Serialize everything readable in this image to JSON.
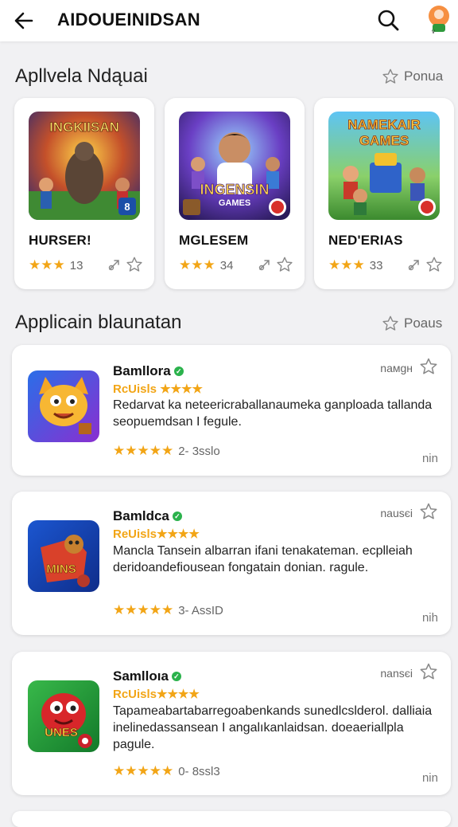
{
  "header": {
    "title": "AIDOUEINIDSAN"
  },
  "featured": {
    "title": "Apllvela Ndąuai",
    "action": "Ponua",
    "cards": [
      {
        "art_text": "INGKIISAN",
        "name": "HURSER!",
        "rating_text": "13"
      },
      {
        "art_text": "INGENSIN",
        "art_sub": "GAMES",
        "name": "MGLESEM",
        "rating_text": "34"
      },
      {
        "art_text": "NAMEKAIR",
        "art_sub": "GAMES",
        "name": "NED'ERIAS",
        "rating_text": "33"
      }
    ]
  },
  "list": {
    "title": "Applicain blaunatan",
    "action": "Poaus",
    "items": [
      {
        "name": "Bamllora",
        "sub": "RcUisls ★★★★",
        "desc": "Redarvat ka neteericraballanaumeka ganploada tallanda seopuemdsan I fegule.",
        "rating_text": "2- 3sslo",
        "tag": "naмgн",
        "foot": "nin"
      },
      {
        "name": "Bamldca",
        "sub": "ReUisls★★★★",
        "desc": "Mancla Tansein albarran ifani tenakateman. ecplleiah deridoandefiousean fongatain donian. ragule.",
        "rating_text": "3- AssID",
        "tag": "nausєi",
        "foot": "nih",
        "icon_text": "MINS"
      },
      {
        "name": "Samlloıa",
        "sub": "RcUisls★★★★",
        "desc": "Tapameabartabarregoabenkands sunedlcslderol. dalliaia inelinedassansean I angalıkanlaidsan. doeaeriallpla pagule.",
        "rating_text": "0- 8ssl3",
        "tag": "nansєi",
        "foot": "nin",
        "icon_text": "UNES"
      }
    ]
  },
  "colors": {
    "accent": "#f2a516",
    "verified": "#2bb24c"
  }
}
